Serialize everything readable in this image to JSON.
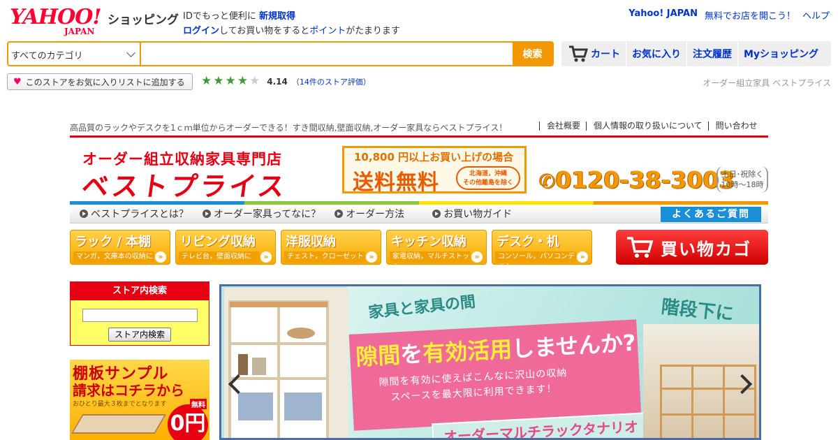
{
  "header": {
    "logo_yahoo": "YAHOO!",
    "logo_japan": "JAPAN",
    "service_name": "ショッピング",
    "id_line1_prefix": "IDでもっと便利に",
    "id_line1_link": "新規取得",
    "id_line2_link": "ログイン",
    "id_line2_mid": "してお買い物をすると",
    "id_line2_link2": "ポイント",
    "id_line2_suffix": "がたまります",
    "top_links": [
      "Yahoo! JAPAN",
      "無料でお店を開こう！",
      "ヘルプ"
    ]
  },
  "search": {
    "category": "すべてのカテゴリ",
    "query": "",
    "button": "検索"
  },
  "nav": {
    "cart": "カート",
    "favorites": "お気に入り",
    "orders": "注文履歴",
    "myshopping": "Myショッピング"
  },
  "store_bar": {
    "favorite_button": "このストアをお気に入りリストに追加する",
    "rating": 4.14,
    "rating_text": "4.14",
    "stars_filled": 4,
    "review_open": "（",
    "review_link": "14件のストア評価",
    "review_close": "）",
    "store_name": "オーダー組立家具 ベストプライス"
  },
  "store_header": {
    "tagline": "高品質のラックやデスクを1ｃｍ単位からオーダーできる！すき間収納,壁面収納,オーダー家具ならベストプライス！",
    "links": [
      "会社概要",
      "個人情報の取り扱いについて",
      "問い合わせ"
    ],
    "title": "オーダー組立収納家具専門店",
    "name": "ベストプライス",
    "free_ship_line1": "10,800 円以上お買い上げの場合",
    "free_ship_line2": "送料無料",
    "free_ship_note1": "北海道，沖縄",
    "free_ship_note2": "その他離島を除く",
    "phone": "0120-38-3003",
    "hours_line1": "土日･祝除く",
    "hours_line2": "10時～18時",
    "color_bar": [
      "#1a8fd8",
      "#8cc63f",
      "#ffe100",
      "#f39800"
    ]
  },
  "subnav": {
    "items": [
      "ベストプライスとは？",
      "オーダー家具ってなに？",
      "オーダー方法",
      "お買い物ガイド"
    ],
    "faq": "よくあるご質問"
  },
  "categories": [
    {
      "label": "ラック / 本棚",
      "sub": "マンガ，文庫本の収納に"
    },
    {
      "label": "リビング収納",
      "sub": "テレビ台，壁面収納に"
    },
    {
      "label": "洋服収納",
      "sub": "チェスト，クローゼット"
    },
    {
      "label": "キッチン収納",
      "sub": "家電収納，マルチストッカー"
    },
    {
      "label": "デスク・机",
      "sub": "コンソール，パソコンデスク"
    }
  ],
  "cart_button": "買い物カゴ",
  "store_search": {
    "title": "ストア内検索",
    "value": "",
    "button": "ストア内検索"
  },
  "sample_banner": {
    "line1": "棚板サンプル",
    "line2": "請求はコチラから",
    "line3": "おひとり最大３枚までとなります",
    "free": "無料",
    "price": "0円"
  },
  "main_banner": {
    "label1": "家具と家具の間",
    "label2": "階段下に",
    "headline_hl1": "隙間",
    "headline_1": "を",
    "headline_hl2": "有効活用",
    "headline_2": "しませんか?",
    "sub1": "隙間を有効に使えばこんなに沢山の収納",
    "sub2": "スペースを最大限に利用できます！",
    "product": "オーダーマルチラックタナリオ"
  }
}
